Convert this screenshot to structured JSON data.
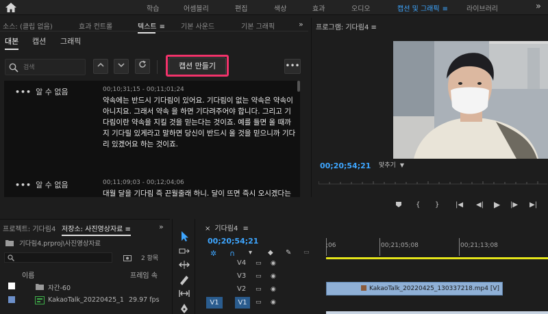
{
  "topbar": {
    "workspaces": [
      {
        "label": "학습",
        "active": false
      },
      {
        "label": "어셈블리",
        "active": false
      },
      {
        "label": "편집",
        "active": false
      },
      {
        "label": "색상",
        "active": false
      },
      {
        "label": "효과",
        "active": false
      },
      {
        "label": "오디오",
        "active": false
      },
      {
        "label": "캡션 및 그래픽",
        "active": true
      },
      {
        "label": "라이브러리",
        "active": false
      }
    ],
    "menu_icon": "≡",
    "more_icon": "»"
  },
  "text_panel": {
    "tabs": [
      {
        "label": "소스: (클립 없음)",
        "active": false
      },
      {
        "label": "효과 컨트롤",
        "active": false
      },
      {
        "label": "텍스트",
        "active": true
      },
      {
        "label": "기본 사운드",
        "active": false
      },
      {
        "label": "기본 그래픽",
        "active": false
      }
    ],
    "tab_menu_icon": "≡",
    "overflow_icon": "»",
    "sub_tabs": [
      {
        "label": "대본",
        "active": true
      },
      {
        "label": "캡션",
        "active": false
      },
      {
        "label": "그래픽",
        "active": false
      }
    ],
    "search_placeholder": "검색",
    "create_captions_label": "캡션 만들기",
    "more_label": "•••",
    "segments": [
      {
        "speaker": "알 수 없음",
        "timecode": "00;10;31;15 - 00;11;01;24",
        "text": "약속에는 반드시 기다림이 있어요. 기다림이 없는 약속은 약속이 아니지요. 그래서 약속 을 하면 기다려주어야 합니다. 그리고 기다림이란 약속을 지킬 것을 믿는다는 것이죠. 예를 들면 올 때까지 기다릴 있게라고 말하면 당신이 반드시 올 것을 믿으니까 기다리 있겠어요 하는 것이죠."
      },
      {
        "speaker": "알 수 없음",
        "timecode": "00;11;09;03 - 00;12;04;06",
        "text": "대월 달을 기다림 즉 끈월줄래 하니. 달이 뜨면 즉시 오시겠다는 이번 5월 주랑 봉 내려 다른 떠올랐지만 님은 아직"
      }
    ]
  },
  "program_monitor": {
    "title": "프로그램: 기다림4",
    "title_menu_icon": "≡",
    "timecode": "00;20;54;21",
    "fit_label": "맞추기"
  },
  "project_panel": {
    "tabs": [
      {
        "label": "프로젝트: 기다림4",
        "active": false
      },
      {
        "label": "저장소: 사진영상자료",
        "active": true
      }
    ],
    "tab_menu_icon": "≡",
    "overflow_icon": "»",
    "path": "기다림4.prproj\\사진영상자료",
    "item_count": "2 항목",
    "columns": {
      "name": "이름",
      "rate": "프레임 속"
    },
    "items": [
      {
        "name": "자간-60",
        "fps": "",
        "type": "bin"
      },
      {
        "name": "KakaoTalk_20220425_1",
        "fps": "29.97 fps",
        "type": "sequence"
      }
    ]
  },
  "timeline": {
    "title": "기다림4",
    "title_menu_icon": "≡",
    "close_icon": "×",
    "timecode": "00;20;54;21",
    "ruler_labels": [
      ";06",
      "00;21;05;08",
      "00;21;13;08"
    ],
    "tracks": [
      {
        "name": "V4",
        "source": "",
        "target": false
      },
      {
        "name": "V3",
        "source": "",
        "target": false
      },
      {
        "name": "V2",
        "source": "",
        "target": false
      },
      {
        "name": "V1",
        "source": "V1",
        "target": true
      }
    ],
    "clip_label": "KakaoTalk_20220425_130337218.mp4 [V]"
  },
  "colors": {
    "accent": "#3ea6ff",
    "highlight": "#f2336b",
    "clip": "#8fb0d6",
    "workarea": "#e6e61a"
  }
}
